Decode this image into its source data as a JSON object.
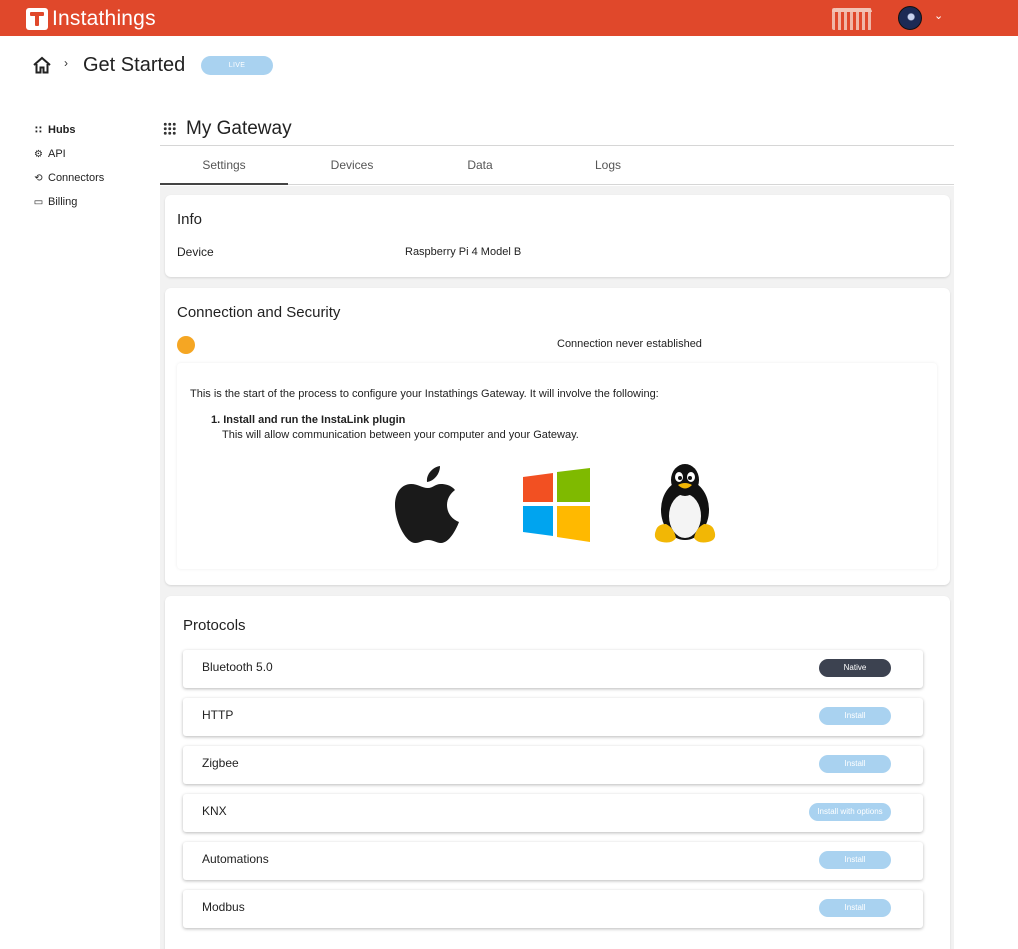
{
  "app": {
    "name": "Instathings"
  },
  "breadcrumb": {
    "separator": "›",
    "title": "Get Started",
    "badge": "LIVE"
  },
  "user": {
    "menu_chevron": "⌄"
  },
  "sidebar": {
    "items": [
      {
        "label": "Hubs",
        "icon": "grid-icon",
        "glyph": "⁞⁞⁞",
        "active": true
      },
      {
        "label": "API",
        "icon": "gear-icon",
        "glyph": "⚙"
      },
      {
        "label": "Connectors",
        "icon": "plug-icon",
        "glyph": "⟲"
      },
      {
        "label": "Billing",
        "icon": "card-icon",
        "glyph": "▭"
      }
    ]
  },
  "main": {
    "title": "My Gateway",
    "tabs": [
      "Settings",
      "Devices",
      "Data",
      "Logs"
    ],
    "active_tab": "Settings"
  },
  "info": {
    "title": "Info",
    "device_label": "Device",
    "device_value": "Raspberry Pi 4 Model B"
  },
  "connection": {
    "title": "Connection and Security",
    "status_color": "#f5a623",
    "status_text": "Connection never established",
    "intro": "This is the start of the process to configure your Instathings Gateway. It will involve the following:",
    "step_title": "1. Install and run the InstaLink plugin",
    "step_desc": "This will allow communication between your computer and your Gateway.",
    "platforms": [
      "apple-icon",
      "windows-icon",
      "linux-icon"
    ]
  },
  "protocols": {
    "title": "Protocols",
    "items": [
      {
        "name": "Bluetooth 5.0",
        "action": "Native",
        "style": "dark"
      },
      {
        "name": "HTTP",
        "action": "Install",
        "style": "light"
      },
      {
        "name": "Zigbee",
        "action": "Install",
        "style": "light"
      },
      {
        "name": "KNX",
        "action": "Install with options",
        "style": "light"
      },
      {
        "name": "Automations",
        "action": "Install",
        "style": "light"
      },
      {
        "name": "Modbus",
        "action": "Install",
        "style": "light"
      }
    ]
  },
  "colors": {
    "brand": "#e0482b",
    "accent_light": "#a9d2f0",
    "native_pill": "#3c4250"
  }
}
